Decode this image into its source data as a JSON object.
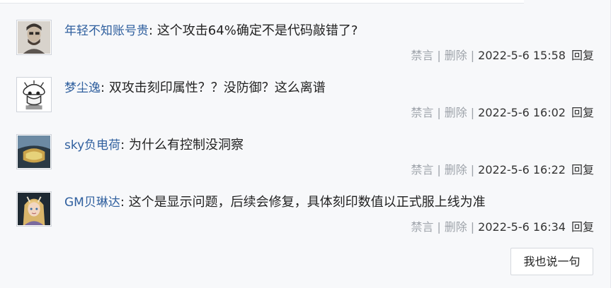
{
  "comments": [
    {
      "user": "年轻不知账号贵",
      "text": "这个攻击64%确定不是代码敲错了?",
      "mute": "禁言",
      "delete": "删除",
      "time": "2022-5-6 15:58",
      "reply": "回复"
    },
    {
      "user": "梦尘逸",
      "text": "双攻击刻印属性？？没防御？这么离谱",
      "mute": "禁言",
      "delete": "删除",
      "time": "2022-5-6 16:02",
      "reply": "回复"
    },
    {
      "user": "sky负电荷",
      "text": "为什么有控制没洞察",
      "mute": "禁言",
      "delete": "删除",
      "time": "2022-5-6 16:22",
      "reply": "回复"
    },
    {
      "user": "GM贝琳达",
      "text": "这个是显示问题，后续会修复，具体刻印数值以正式服上线为准",
      "mute": "禁言",
      "delete": "删除",
      "time": "2022-5-6 16:34",
      "reply": "回复"
    }
  ],
  "separator": "|",
  "colon": ":",
  "reply_button": "我也说一句",
  "colors": {
    "username": "#2f5f9e",
    "meta": "#9ea3aa",
    "background": "#f7f8fa"
  }
}
